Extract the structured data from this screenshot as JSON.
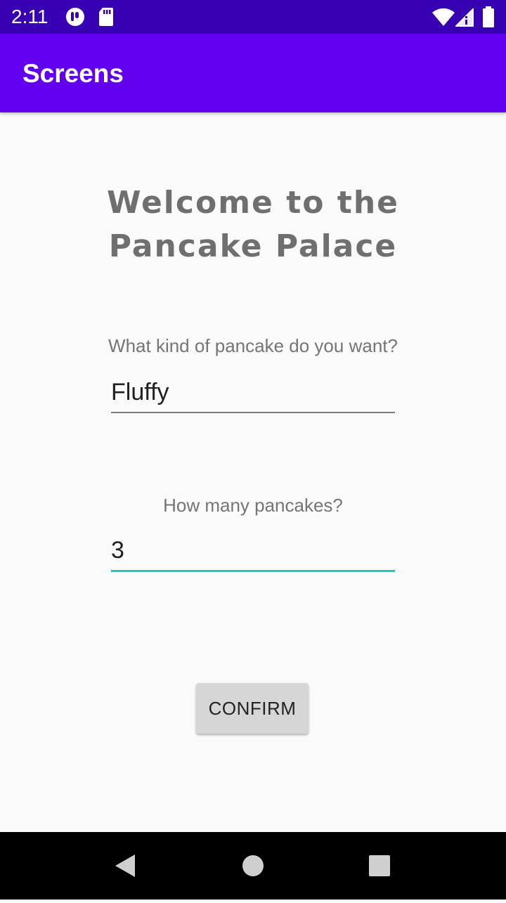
{
  "status_bar": {
    "time": "2:11",
    "icons": [
      "notification-app-icon",
      "sd-card-icon",
      "wifi-icon",
      "signal-icon",
      "battery-icon"
    ]
  },
  "app_bar": {
    "title": "Screens"
  },
  "main": {
    "welcome_text": "Welcome to the Pancake Palace",
    "kind_question": "What kind of pancake do you want?",
    "kind_value": "Fluffy",
    "count_question": "How many pancakes?",
    "count_value": "3",
    "confirm_label": "CONFIRM"
  },
  "nav_bar": {
    "icons": [
      "back-icon",
      "home-icon",
      "recents-icon"
    ]
  },
  "colors": {
    "status_bar": "#3700b3",
    "app_bar": "#6200ee",
    "accent": "#1dcbc6",
    "background": "#fafafa"
  }
}
